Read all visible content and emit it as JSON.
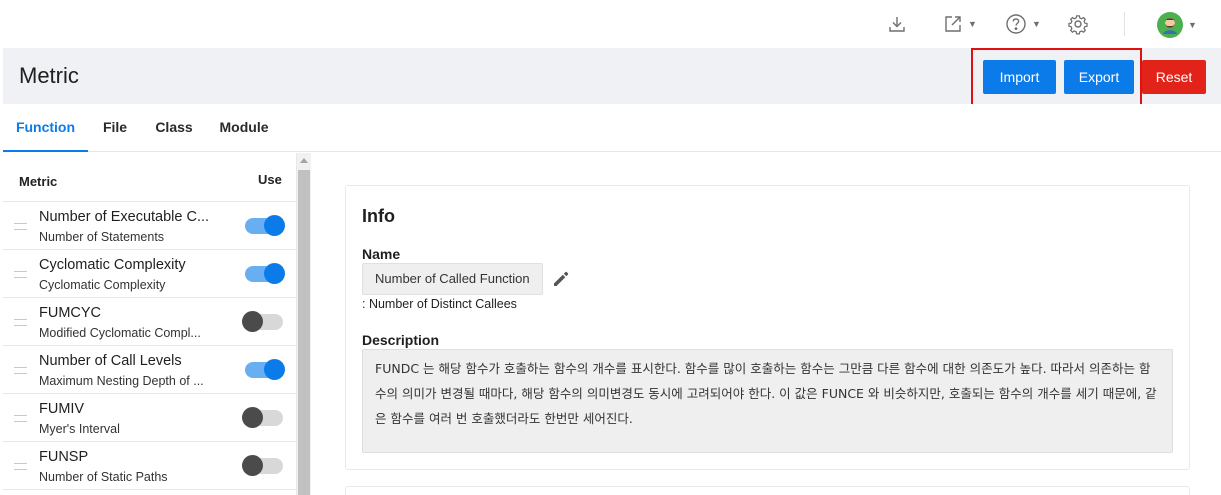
{
  "page": {
    "title": "Metric"
  },
  "toolbar": {
    "import_label": "Import",
    "export_label": "Export",
    "reset_label": "Reset"
  },
  "topbar": {
    "icons": [
      "download-icon",
      "external-link-icon",
      "help-icon",
      "settings-icon",
      "avatar"
    ]
  },
  "tabs": [
    {
      "label": "Function",
      "active": true
    },
    {
      "label": "File",
      "active": false
    },
    {
      "label": "Class",
      "active": false
    },
    {
      "label": "Module",
      "active": false
    }
  ],
  "metric_list": {
    "header_metric": "Metric",
    "header_use": "Use",
    "items": [
      {
        "name": "Number of Executable C...",
        "sub": "Number of Statements",
        "enabled": true
      },
      {
        "name": "Cyclomatic Complexity",
        "sub": "Cyclomatic Complexity",
        "enabled": true
      },
      {
        "name": "FUMCYC",
        "sub": "Modified Cyclomatic Compl...",
        "enabled": false
      },
      {
        "name": "Number of Call Levels",
        "sub": "Maximum Nesting Depth of ...",
        "enabled": true
      },
      {
        "name": "FUMIV",
        "sub": "Myer's Interval",
        "enabled": false
      },
      {
        "name": "FUNSP",
        "sub": "Number of Static Paths",
        "enabled": false
      }
    ]
  },
  "info": {
    "title": "Info",
    "name_label": "Name",
    "name_value": "Number of Called Function",
    "name_sub": ": Number of Distinct Callees",
    "description_label": "Description",
    "description": "FUNDC 는 해당 함수가 호출하는 함수의 개수를 표시한다. 함수를 많이 호출하는 함수는 그만큼 다른 함수에 대한 의존도가 높다. 따라서 의존하는 함수의 의미가 변경될 때마다, 해당 함수의 의미변경도 동시에 고려되어야 한다. 이 값은 FUNCE 와 비슷하지만, 호출되는 함수의 개수를 세기 때문에, 같은 함수를 여러 번 호출했더라도 한번만 세어진다."
  },
  "colors": {
    "primary": "#0c7bea",
    "danger": "#e2231a",
    "highlight": "#e10f0f"
  }
}
